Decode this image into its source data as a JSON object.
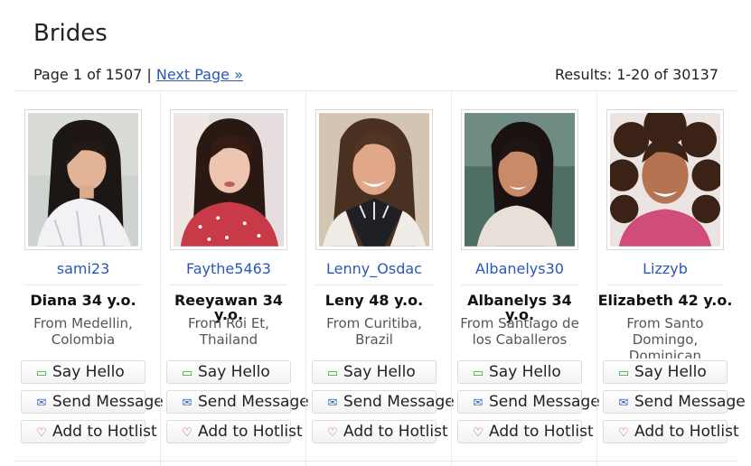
{
  "title": "Brides",
  "pager": {
    "page_text": "Page 1 of 1507 |",
    "next_label": "Next Page »",
    "results": "Results: 1-20 of 30137"
  },
  "profiles": [
    {
      "username": "sami23",
      "name_age": "Diana 34 y.o.",
      "origin": "From Medellin, Colombia"
    },
    {
      "username": "Faythe5463",
      "name_age": "Reeyawan 34 y.o.",
      "origin": "From Roi Et, Thailand"
    },
    {
      "username": "Lenny_Osdac",
      "name_age": "Leny 48 y.o.",
      "origin": "From Curitiba, Brazil"
    },
    {
      "username": "Albanelys30",
      "name_age": "Albanelys 34 y.o.",
      "origin": "From Santiago de los Caballeros"
    },
    {
      "username": "Lizzyb",
      "name_age": "Elizabeth 42 y.o.",
      "origin": "From Santo Domingo, Dominican"
    }
  ],
  "actions": {
    "hello": "Say Hello",
    "message": "Send Message",
    "hotlist": "Add to Hotlist"
  },
  "icons": {
    "hello": "speech-bubble-icon",
    "message": "envelope-icon",
    "hotlist": "heart-icon"
  },
  "colors": {
    "link": "#2a57b8",
    "hello_icon": "#3aa33a",
    "message_icon": "#3b66c4",
    "heart_icon": "#d23a3a"
  }
}
